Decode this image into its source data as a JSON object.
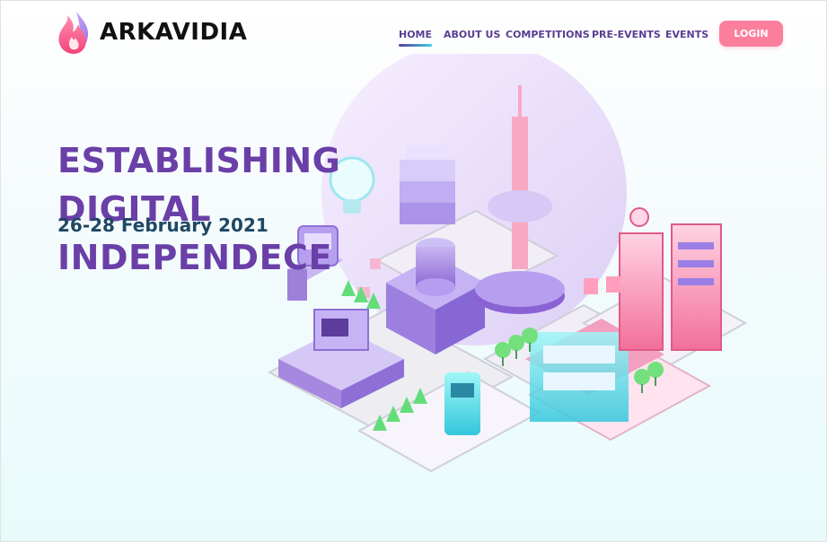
{
  "brand": {
    "name": "ARKAVIDIA",
    "icon": "flame-logo-icon"
  },
  "nav": {
    "items": [
      {
        "label": "HOME",
        "active": true
      },
      {
        "label": "ABOUT US",
        "active": false
      },
      {
        "label": "COMPETITIONS",
        "active": false
      },
      {
        "label": "PRE-EVENTS",
        "active": false
      },
      {
        "label": "EVENTS",
        "active": false
      }
    ],
    "login_label": "LOGIN"
  },
  "hero": {
    "title_line1": "ESTABLISHING DIGITAL",
    "title_line2": "INDEPENDECE",
    "date": "26-28 February 2021"
  },
  "colors": {
    "title": "#6a3fa8",
    "date": "#1f4763",
    "nav": "#5a3d92",
    "login_bg": "#fb7f9c",
    "accent_cyan": "#3ed1e3"
  }
}
